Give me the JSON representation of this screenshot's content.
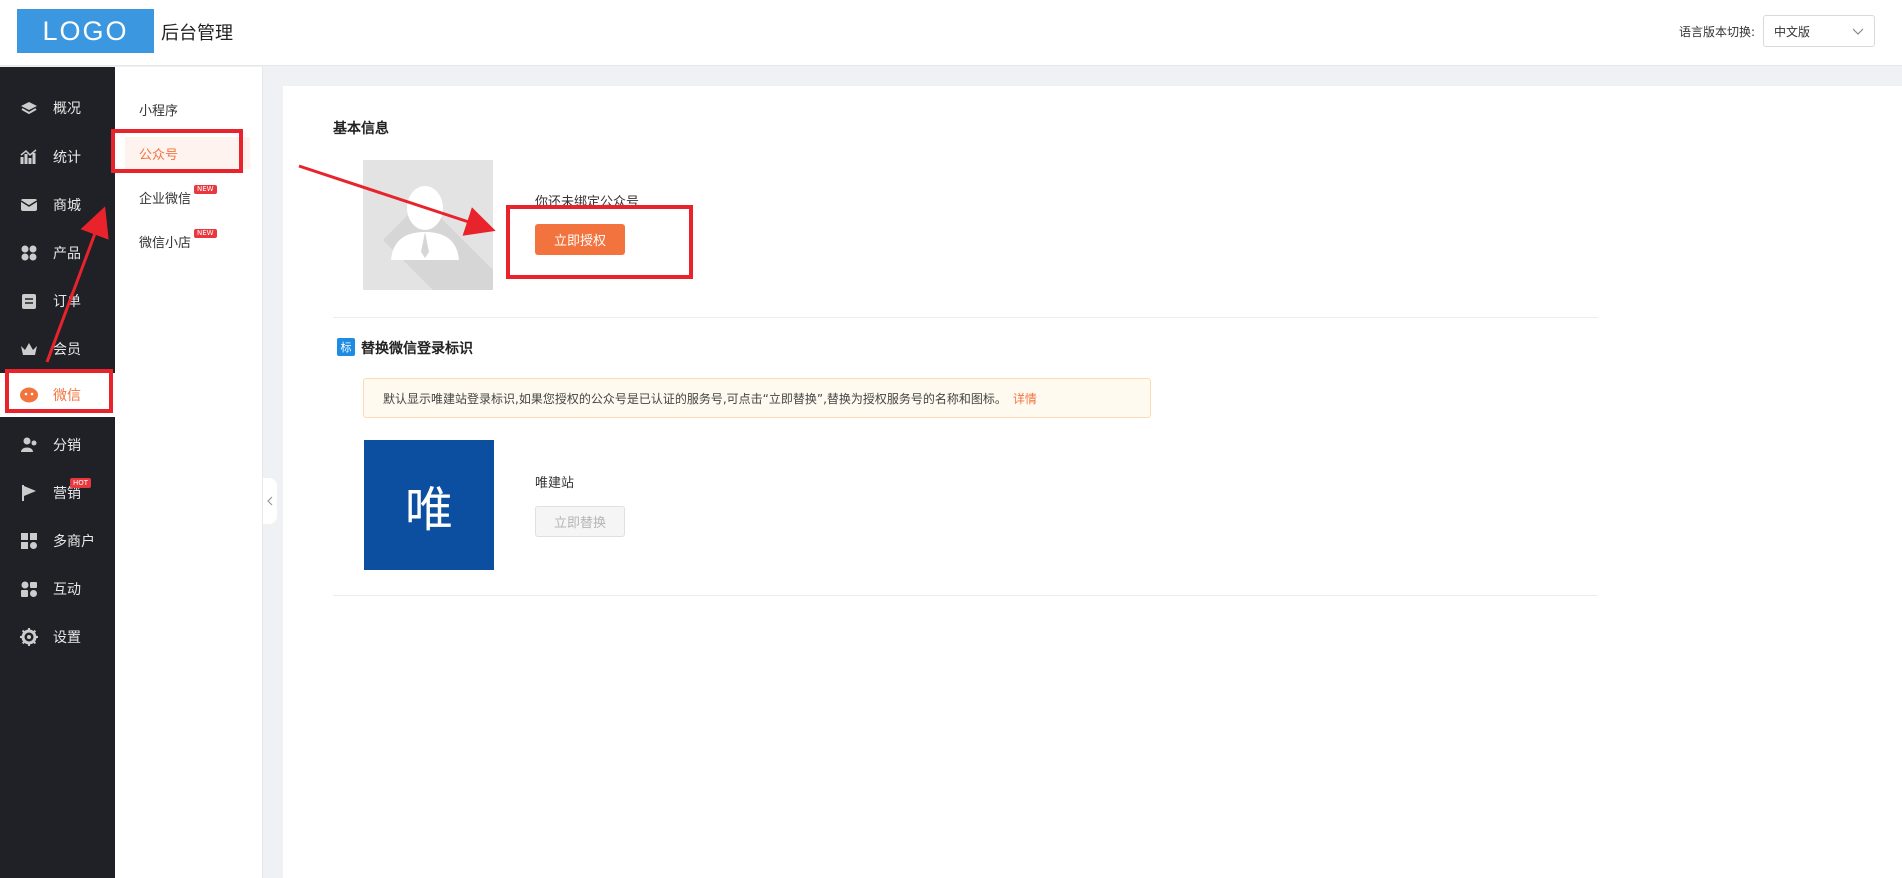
{
  "header": {
    "logo": "LOGO",
    "title": "后台管理",
    "language_label": "语言版本切换:",
    "language_value": "中文版"
  },
  "sidebar": {
    "items": [
      {
        "label": "概况",
        "icon": "layers-icon"
      },
      {
        "label": "统计",
        "icon": "chart-icon"
      },
      {
        "label": "商城",
        "icon": "mail-icon"
      },
      {
        "label": "产品",
        "icon": "grid-icon"
      },
      {
        "label": "订单",
        "icon": "clipboard-icon"
      },
      {
        "label": "会员",
        "icon": "crown-icon"
      },
      {
        "label": "微信",
        "icon": "wechat-icon",
        "active": true
      },
      {
        "label": "分销",
        "icon": "users-icon"
      },
      {
        "label": "营销",
        "icon": "flag-icon",
        "badge": "HOT"
      },
      {
        "label": "多商户",
        "icon": "store-icon"
      },
      {
        "label": "互动",
        "icon": "interact-icon"
      },
      {
        "label": "设置",
        "icon": "gear-icon"
      }
    ]
  },
  "submenu": {
    "items": [
      {
        "label": "小程序"
      },
      {
        "label": "公众号",
        "active": true
      },
      {
        "label": "企业微信",
        "badge": "NEW"
      },
      {
        "label": "微信小店",
        "badge": "NEW"
      }
    ]
  },
  "main": {
    "basic_info_title": "基本信息",
    "unbound_text": "你还未绑定公众号",
    "authorize_button": "立即授权",
    "replace_section_title": "替换微信登录标识",
    "tag_icon_text": "标",
    "notice_text": "默认显示唯建站登录标识,如果您授权的公众号是已认证的服务号,可点击“立即替换”,替换为授权服务号的名称和图标。",
    "notice_link": "详情",
    "brand_tile_text": "唯",
    "brand_name": "唯建站",
    "replace_button": "立即替换"
  },
  "colors": {
    "accent": "#f2733d",
    "logo_bg": "#3a97e0",
    "sidebar_bg": "#1f2127",
    "brand_tile": "#0c4fa0",
    "annotation": "#e8232b"
  }
}
